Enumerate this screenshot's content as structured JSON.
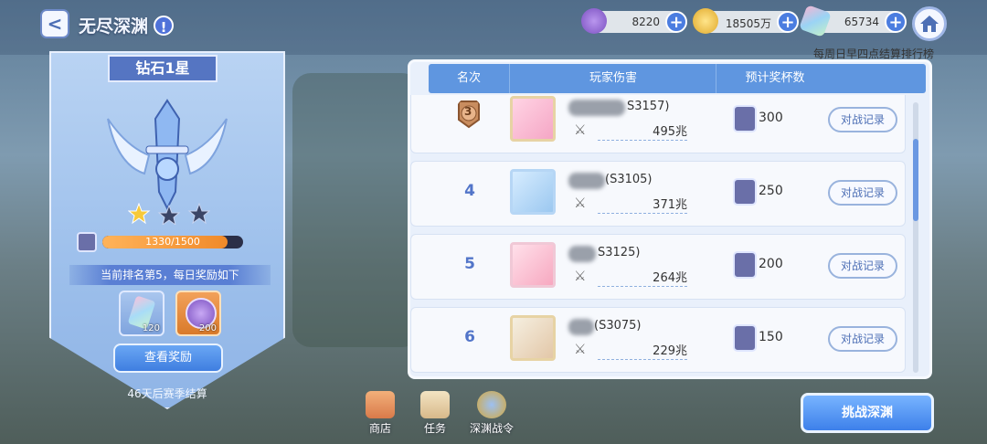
{
  "header": {
    "back_label": "<",
    "title": "无尽深渊",
    "info_label": "!",
    "resources": [
      {
        "name": "purple-coin",
        "value": "8220",
        "color": "#8b62c9"
      },
      {
        "name": "gold-coin",
        "value": "18505万",
        "color": "#f4c542"
      },
      {
        "name": "crystal",
        "value": "65734",
        "color": "#e6a0c8"
      }
    ],
    "plus_label": "+",
    "weekly_note": "每周日早四点结算排行榜"
  },
  "left_panel": {
    "tier": "钻石1星",
    "stars_filled": 1,
    "stars_total": 3,
    "exp_current": 1330,
    "exp_max": 1500,
    "exp_text": "1330/1500",
    "rank_text": "当前排名第5，每日奖励如下",
    "rewards": [
      {
        "name": "crystal",
        "qty": "120"
      },
      {
        "name": "purple-coin",
        "qty": "200"
      }
    ],
    "view_reward_label": "查看奖励",
    "season_end": "46天后赛季结算"
  },
  "table": {
    "headers": [
      "名次",
      "玩家伤害",
      "预计奖杯数"
    ],
    "record_label": "对战记录",
    "rows": [
      {
        "rank": "3",
        "medal": true,
        "name": "S3157)",
        "damage": "495兆",
        "trophies": "300"
      },
      {
        "rank": "4",
        "medal": false,
        "name": "(S3105)",
        "damage": "371兆",
        "trophies": "250"
      },
      {
        "rank": "5",
        "medal": false,
        "name": "S3125)",
        "damage": "264兆",
        "trophies": "200"
      },
      {
        "rank": "6",
        "medal": false,
        "name": "(S3075)",
        "damage": "229兆",
        "trophies": "150"
      }
    ]
  },
  "bottom_nav": [
    {
      "icon": "shop-icon",
      "label": "商店"
    },
    {
      "icon": "task-icon",
      "label": "任务"
    },
    {
      "icon": "battle-pass-icon",
      "label": "深渊战令"
    }
  ],
  "challenge_label": "挑战深渊",
  "sword_glyph": "⚔"
}
